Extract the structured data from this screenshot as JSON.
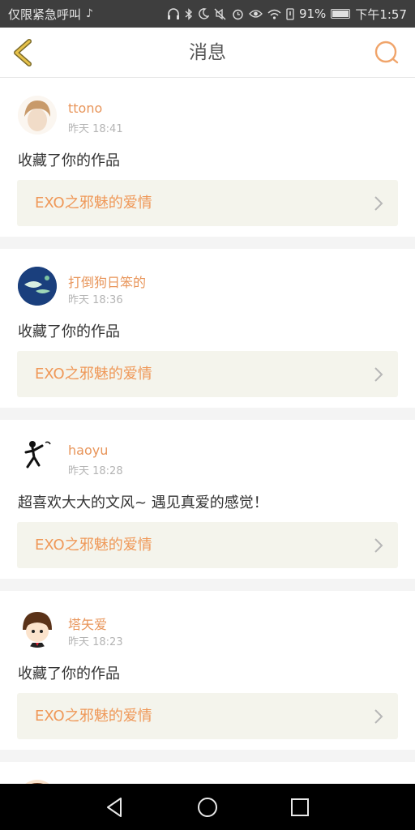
{
  "status_bar": {
    "carrier_text": "仅限紧急呼叫",
    "battery": "91%",
    "time": "下午1:57",
    "icons": [
      "tiktok-icon",
      "headphones-icon",
      "bluetooth-icon",
      "moon-icon",
      "mute-icon",
      "alarm-icon",
      "eye-icon",
      "wifi-icon",
      "sim-icon",
      "battery-icon"
    ]
  },
  "header": {
    "title": "消息",
    "back_icon": "chevron-left-icon",
    "search_icon": "search-icon",
    "accent_color": "#e7a444"
  },
  "messages": [
    {
      "username": "ttono",
      "time": "昨天 18:41",
      "text": "收藏了你的作品",
      "work_title": "EXO之邪魅的爱情"
    },
    {
      "username": "打倒狗日笨的",
      "time": "昨天 18:36",
      "text": "收藏了你的作品",
      "work_title": "EXO之邪魅的爱情"
    },
    {
      "username": "haoyu",
      "time": "昨天 18:28",
      "text": "超喜欢大大的文风~ 遇见真爱的感觉！",
      "work_title": "EXO之邪魅的爱情"
    },
    {
      "username": "塔矢爱",
      "time": "昨天 18:23",
      "text": "收藏了你的作品",
      "work_title": "EXO之邪魅的爱情"
    }
  ],
  "colors": {
    "username": "#e8955a",
    "work_title": "#ef9858",
    "work_bg": "#f4f4ec"
  },
  "nav": {
    "icons": [
      "back-triangle-icon",
      "home-circle-icon",
      "recent-square-icon"
    ]
  }
}
